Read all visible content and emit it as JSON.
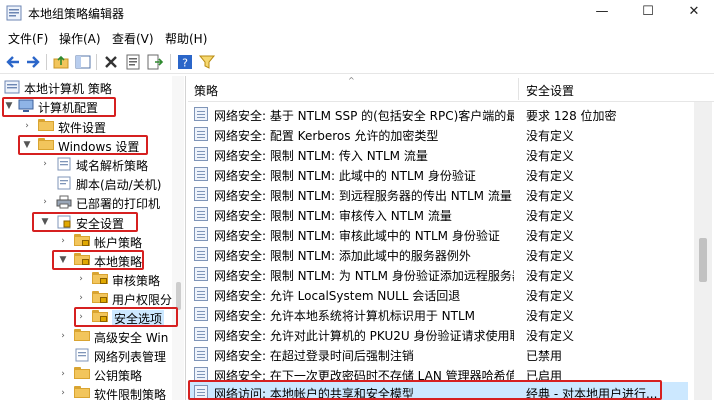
{
  "window": {
    "title": "本地组策略编辑器",
    "minimize": "—",
    "maximize": "☐",
    "close": "✕"
  },
  "menu": [
    "文件(F)",
    "操作(A)",
    "查看(V)",
    "帮助(H)"
  ],
  "toolbar": {
    "icons": [
      "back-icon",
      "forward-icon",
      "up-folder-icon",
      "show-hide-tree-icon",
      "delete-icon",
      "properties-icon",
      "export-list-icon",
      "help-icon",
      "filter-icon"
    ]
  },
  "tree": {
    "root": "本地计算机 策略",
    "computer_config": "计算机配置",
    "software_settings": "软件设置",
    "windows_settings": "Windows 设置",
    "dns_policy": "域名解析策略",
    "scripts": "脚本(启动/关机)",
    "printers": "已部署的打印机",
    "security_settings": "安全设置",
    "account_policies": "帐户策略",
    "local_policies": "本地策略",
    "audit_policy": "审核策略",
    "user_rights": "用户权限分",
    "security_options": "安全选项",
    "windows_firewall": "高级安全 Win",
    "network_list": "网络列表管理",
    "public_key": "公钥策略",
    "software_restriction": "软件限制策略"
  },
  "list": {
    "col_policy": "策略",
    "col_setting": "安全设置",
    "rows": [
      {
        "name": "网络安全: 基于 NTLM SSP 的(包括安全 RPC)客户端的最小...",
        "value": "要求 128 位加密"
      },
      {
        "name": "网络安全: 配置 Kerberos 允许的加密类型",
        "value": "没有定义"
      },
      {
        "name": "网络安全: 限制 NTLM: 传入 NTLM 流量",
        "value": "没有定义"
      },
      {
        "name": "网络安全: 限制 NTLM: 此域中的 NTLM 身份验证",
        "value": "没有定义"
      },
      {
        "name": "网络安全: 限制 NTLM: 到远程服务器的传出 NTLM 流量",
        "value": "没有定义"
      },
      {
        "name": "网络安全: 限制 NTLM: 审核传入 NTLM 流量",
        "value": "没有定义"
      },
      {
        "name": "网络安全: 限制 NTLM: 审核此域中的 NTLM 身份验证",
        "value": "没有定义"
      },
      {
        "name": "网络安全: 限制 NTLM: 添加此域中的服务器例外",
        "value": "没有定义"
      },
      {
        "name": "网络安全: 限制 NTLM: 为 NTLM 身份验证添加远程服务器...",
        "value": "没有定义"
      },
      {
        "name": "网络安全: 允许 LocalSystem NULL 会话回退",
        "value": "没有定义"
      },
      {
        "name": "网络安全: 允许本地系统将计算机标识用于 NTLM",
        "value": "没有定义"
      },
      {
        "name": "网络安全: 允许对此计算机的 PKU2U 身份验证请求使用联...",
        "value": "没有定义"
      },
      {
        "name": "网络安全: 在超过登录时间后强制注销",
        "value": "已禁用"
      },
      {
        "name": "网络安全: 在下一次更改密码时不存储 LAN 管理器哈希值",
        "value": "已启用"
      },
      {
        "name": "网络访问: 本地帐户的共享和安全模型",
        "value": "经典 - 对本地用户进行..."
      }
    ]
  }
}
